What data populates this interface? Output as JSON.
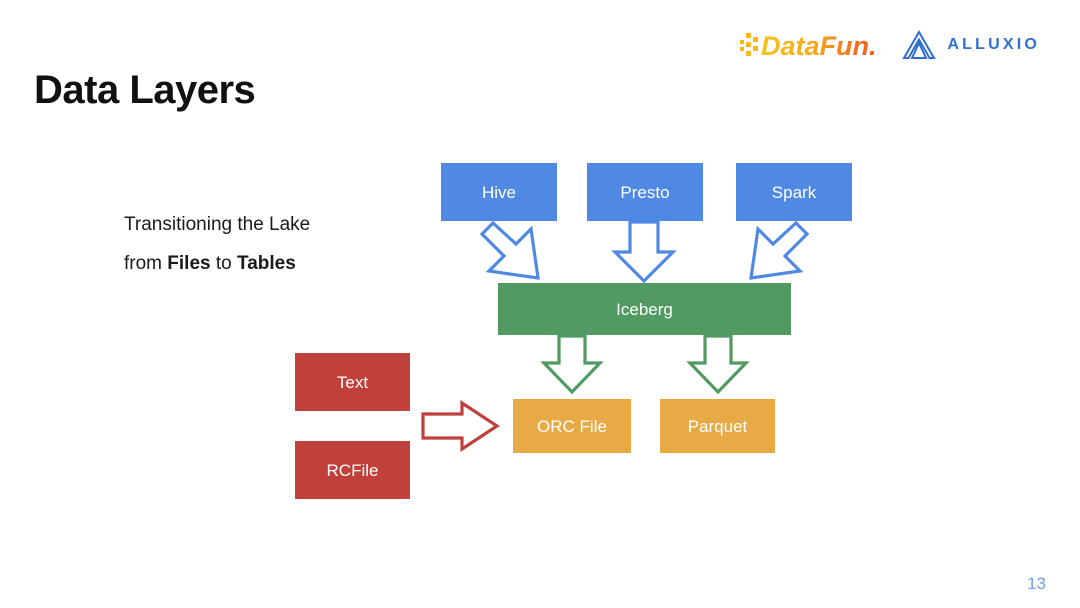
{
  "slide": {
    "title": "Data Layers",
    "page_number": "13",
    "background_color": "#ffffff"
  },
  "logos": {
    "datafun": {
      "name": "datafun-logo",
      "text": "DataFun.",
      "colors": {
        "start": "#f5c518",
        "mid": "#f7a81b",
        "end": "#f2541f"
      }
    },
    "alluxio": {
      "name": "alluxio-logo",
      "text": "ALLUXIO",
      "color": "#2f6fd0"
    }
  },
  "caption": {
    "line1": "Transitioning the Lake",
    "line2_prefix": "from ",
    "line2_bold1": "Files",
    "line2_middle": " to ",
    "line2_bold2": "Tables"
  },
  "diagram": {
    "engines": [
      {
        "label": "Hive",
        "color": "#5089e4"
      },
      {
        "label": "Presto",
        "color": "#5089e4"
      },
      {
        "label": "Spark",
        "color": "#5089e4"
      }
    ],
    "table_format": {
      "label": "Iceberg",
      "color": "#519a62"
    },
    "file_formats": [
      {
        "label": "ORC File",
        "color": "#e8aa44"
      },
      {
        "label": "Parquet",
        "color": "#e8aa44"
      }
    ],
    "legacy_files": [
      {
        "label": "Text",
        "color": "#c0413b"
      },
      {
        "label": "RCFile",
        "color": "#c0413b"
      }
    ],
    "arrows": {
      "engine_to_iceberg_color": "#5089e4",
      "iceberg_to_file_color": "#519a62",
      "legacy_to_modern_color": "#c0413b"
    }
  }
}
